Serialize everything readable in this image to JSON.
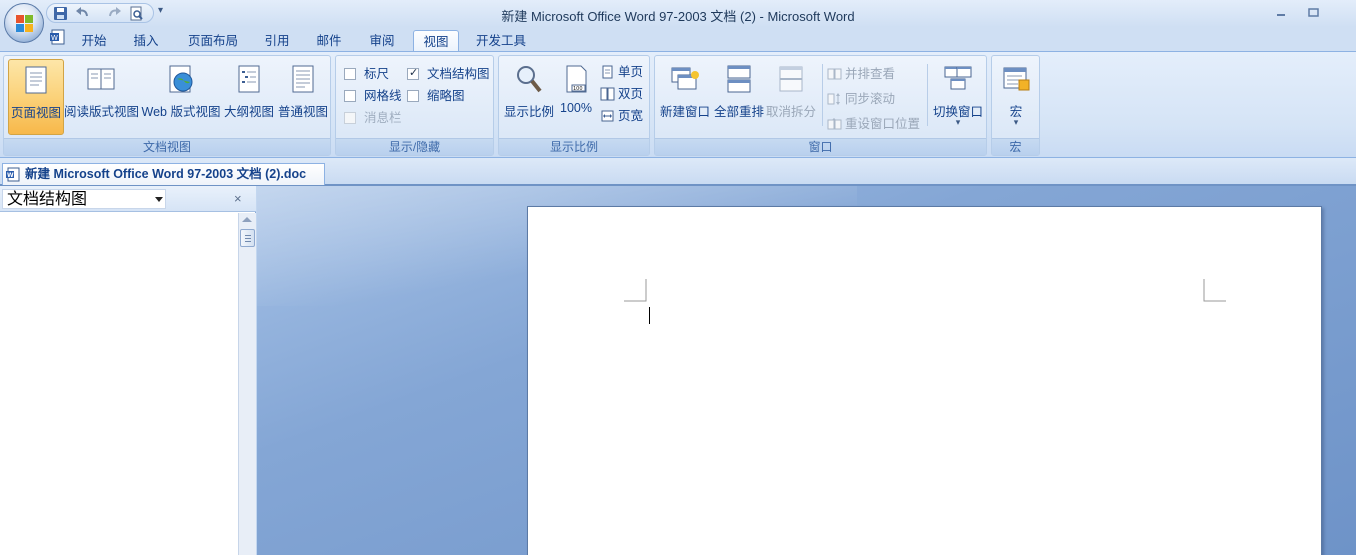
{
  "window": {
    "title": "新建 Microsoft Office Word 97-2003 文档 (2) - Microsoft Word"
  },
  "tabs": [
    {
      "label": "开始",
      "active": false
    },
    {
      "label": "插入",
      "active": false
    },
    {
      "label": "页面布局",
      "active": false
    },
    {
      "label": "引用",
      "active": false
    },
    {
      "label": "邮件",
      "active": false
    },
    {
      "label": "审阅",
      "active": false
    },
    {
      "label": "视图",
      "active": true
    },
    {
      "label": "开发工具",
      "active": false
    }
  ],
  "ribbon": {
    "doc_views": {
      "label": "文档视图",
      "buttons": [
        {
          "label": "页面视图",
          "icon": "page-view-icon",
          "selected": true
        },
        {
          "label": "阅读版式视图",
          "icon": "reading-layout-icon",
          "selected": false
        },
        {
          "label": "Web 版式视图",
          "icon": "web-layout-icon",
          "selected": false
        },
        {
          "label": "大纲视图",
          "icon": "outline-view-icon",
          "selected": false
        },
        {
          "label": "普通视图",
          "icon": "draft-view-icon",
          "selected": false
        }
      ]
    },
    "show_hide": {
      "label": "显示/隐藏",
      "checks": [
        {
          "label": "标尺",
          "checked": false,
          "enabled": true
        },
        {
          "label": "网格线",
          "checked": false,
          "enabled": true
        },
        {
          "label": "消息栏",
          "checked": false,
          "enabled": false
        },
        {
          "label": "文档结构图",
          "checked": true,
          "enabled": true
        },
        {
          "label": "缩略图",
          "checked": false,
          "enabled": true
        }
      ]
    },
    "zoom": {
      "label": "显示比例",
      "zoom_label": "显示比例",
      "hundred_label": "100%",
      "one_page": "单页",
      "two_pages": "双页",
      "page_width": "页宽"
    },
    "window_group": {
      "label": "窗口",
      "new_window": "新建窗口",
      "arrange_all": "全部重排",
      "remove_split": "取消拆分",
      "side_by_side": "并排查看",
      "sync_scroll": "同步滚动",
      "reset_position": "重设窗口位置",
      "switch_windows": "切换窗口"
    },
    "macros": {
      "label": "宏",
      "button": "宏"
    }
  },
  "document_tab": {
    "label": "新建 Microsoft Office Word 97-2003 文档 (2).doc"
  },
  "nav_pane": {
    "selected": "文档结构图",
    "close_glyph": "×"
  },
  "colors": {
    "accent": "#15428b",
    "selected_button": "#fbd27a",
    "workspace": "#84a6d5"
  }
}
